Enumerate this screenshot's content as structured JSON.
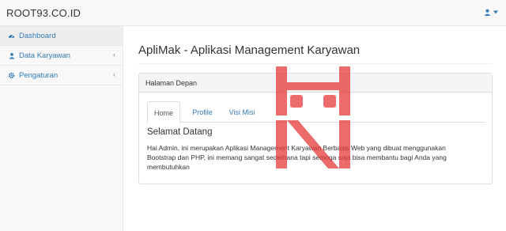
{
  "app": {
    "brand": "ROOT93.CO.ID"
  },
  "user_menu": {
    "icon": "user-icon",
    "caret": "caret-down-icon"
  },
  "sidebar": {
    "items": [
      {
        "label": "Dashboard",
        "icon": "dashboard-icon",
        "active": true,
        "has_submenu": false
      },
      {
        "label": "Data Karyawan",
        "icon": "user-icon",
        "active": false,
        "has_submenu": true
      },
      {
        "label": "Pengaturan",
        "icon": "gear-icon",
        "active": false,
        "has_submenu": true
      }
    ]
  },
  "main": {
    "title": "ApliMak - Aplikasi Management Karyawan",
    "panel": {
      "heading": "Halaman Depan",
      "tabs": [
        {
          "label": "Home",
          "active": true
        },
        {
          "label": "Profile",
          "active": false
        },
        {
          "label": "Visi Misi",
          "active": false
        }
      ],
      "content": {
        "heading": "Selamat Datang",
        "body": "Hai Admin, ini merupakan Aplikasi Management Karyawan Berbasis Web yang dibuat menggunakan Bootstrap dan PHP, ini memang sangat sederhana tapi semoga saja bisa membantu bagi Anda yang membutuhkan"
      }
    }
  },
  "colors": {
    "link": "#337ab7",
    "watermark": "#e63b3b",
    "border": "#dddddd"
  }
}
